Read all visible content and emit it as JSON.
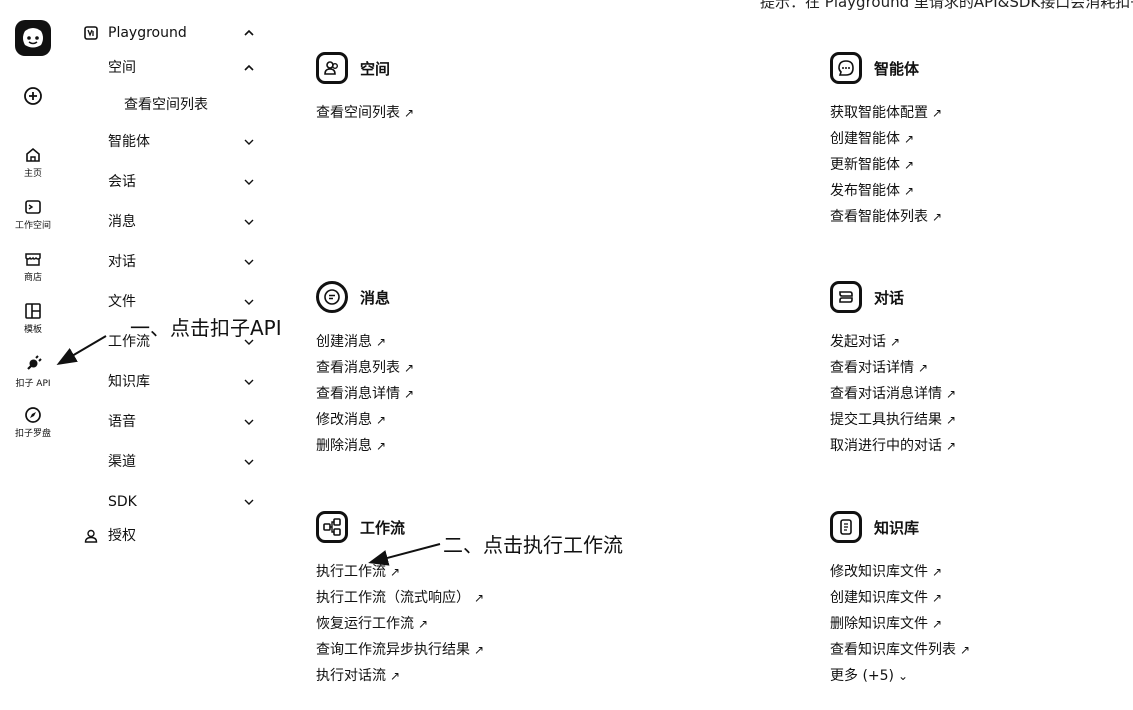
{
  "top_note": "提示：在 Playground 里请求的API&SDK接口会消耗扣子资源",
  "rail": {
    "items": [
      {
        "label": "主页",
        "icon": "home-icon"
      },
      {
        "label": "工作空间",
        "icon": "terminal-icon"
      },
      {
        "label": "商店",
        "icon": "store-icon"
      },
      {
        "label": "模板",
        "icon": "template-icon"
      },
      {
        "label": "扣子 API",
        "icon": "plug-icon"
      },
      {
        "label": "扣子罗盘",
        "icon": "compass-icon"
      }
    ]
  },
  "menu": {
    "playground": "Playground",
    "space": "空间",
    "space_sub": "查看空间列表",
    "items": [
      "智能体",
      "会话",
      "消息",
      "对话",
      "文件",
      "工作流",
      "知识库",
      "语音",
      "渠道",
      "SDK"
    ],
    "auth": "授权"
  },
  "sections": {
    "space": {
      "title": "空间",
      "links": [
        "查看空间列表"
      ]
    },
    "agent": {
      "title": "智能体",
      "links": [
        "获取智能体配置",
        "创建智能体",
        "更新智能体",
        "发布智能体",
        "查看智能体列表"
      ]
    },
    "message": {
      "title": "消息",
      "links": [
        "创建消息",
        "查看消息列表",
        "查看消息详情",
        "修改消息",
        "删除消息"
      ]
    },
    "chat": {
      "title": "对话",
      "links": [
        "发起对话",
        "查看对话详情",
        "查看对话消息详情",
        "提交工具执行结果",
        "取消进行中的对话"
      ]
    },
    "workflow": {
      "title": "工作流",
      "links": [
        "执行工作流",
        "执行工作流（流式响应）",
        "恢复运行工作流",
        "查询工作流异步执行结果",
        "执行对话流"
      ]
    },
    "knowledge": {
      "title": "知识库",
      "links": [
        "修改知识库文件",
        "创建知识库文件",
        "删除知识库文件",
        "查看知识库文件列表"
      ],
      "more": "更多 (+5)"
    }
  },
  "annotations": {
    "step1": "一、点击扣子API",
    "step2": "二、点击执行工作流"
  }
}
